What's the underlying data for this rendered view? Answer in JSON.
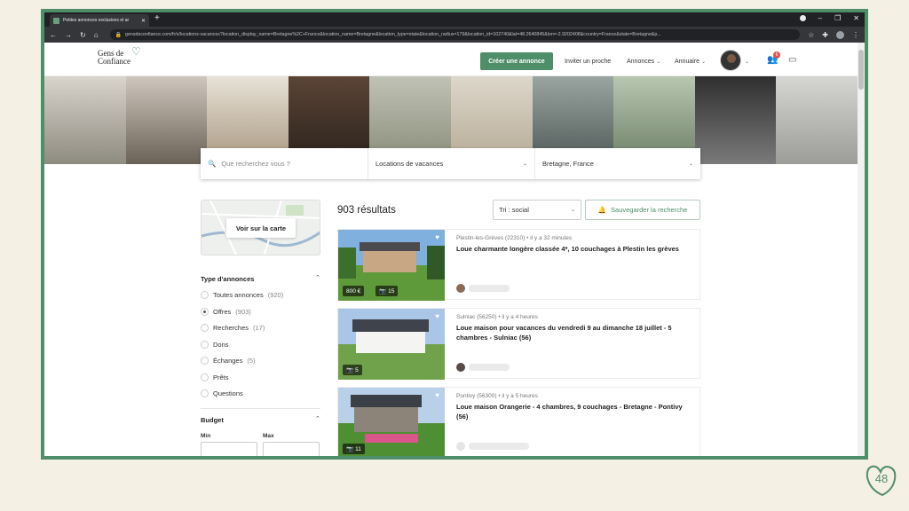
{
  "browser": {
    "tab_title": "Petites annonces exclusives et ar",
    "url": "gensdeconfiance.com/fr/s/locations-vacances?location_display_name=Bretagne%2C+France&location_name=Bretagne&location_type=state&location_radius=179&location_id=102740&lat=48.2640845&lon=-2.9202408&country=France&state=Bretagne&p..."
  },
  "header": {
    "logo_line1": "Gens de",
    "logo_line2": "Confiance",
    "create_button": "Créer une annonce",
    "invite": "Inviter un proche",
    "annonces": "Annonces",
    "annuaire": "Annuaire",
    "notification_count": "6"
  },
  "search": {
    "placeholder": "Que recherchez vous ?",
    "category": "Locations de vacances",
    "location": "Bretagne, France"
  },
  "map_button": "Voir sur la carte",
  "filters": {
    "type_title": "Type d'annonces",
    "options": [
      {
        "label": "Toutes annonces",
        "count": "(920)"
      },
      {
        "label": "Offres",
        "count": "(903)"
      },
      {
        "label": "Recherches",
        "count": "(17)"
      },
      {
        "label": "Dons",
        "count": ""
      },
      {
        "label": "Échanges",
        "count": "(5)"
      },
      {
        "label": "Prêts",
        "count": ""
      },
      {
        "label": "Questions",
        "count": ""
      }
    ],
    "selected_option": "Offres",
    "budget_title": "Budget",
    "min_label": "Min",
    "max_label": "Max"
  },
  "results": {
    "count": "903 résultats",
    "sort": "Tri : social",
    "save_search": "Sauvegarder la recherche",
    "listings": [
      {
        "meta": "Plestin-les-Grèves (22310)  •  il y a 32 minutes",
        "title": "Loue charmante longère classée 4*, 10 couchages à Plestin les grèves",
        "price": "800 €",
        "photos": "15"
      },
      {
        "meta": "Sulniac (56250)  •  il y a 4 heures",
        "title": "Loue maison pour vacances du vendredi 9 au dimanche 18 juillet - 5 chambres - Sulniac (56)",
        "price": "",
        "photos": "5"
      },
      {
        "meta": "Pontivy (56300)  •  il y a 5 heures",
        "title": "Loue maison Orangerie - 4 chambres, 9 couchages - Bretagne - Pontivy (56)",
        "price": "",
        "photos": "11"
      }
    ]
  },
  "page_number": "48",
  "colors": {
    "brand": "#4e8e68"
  }
}
